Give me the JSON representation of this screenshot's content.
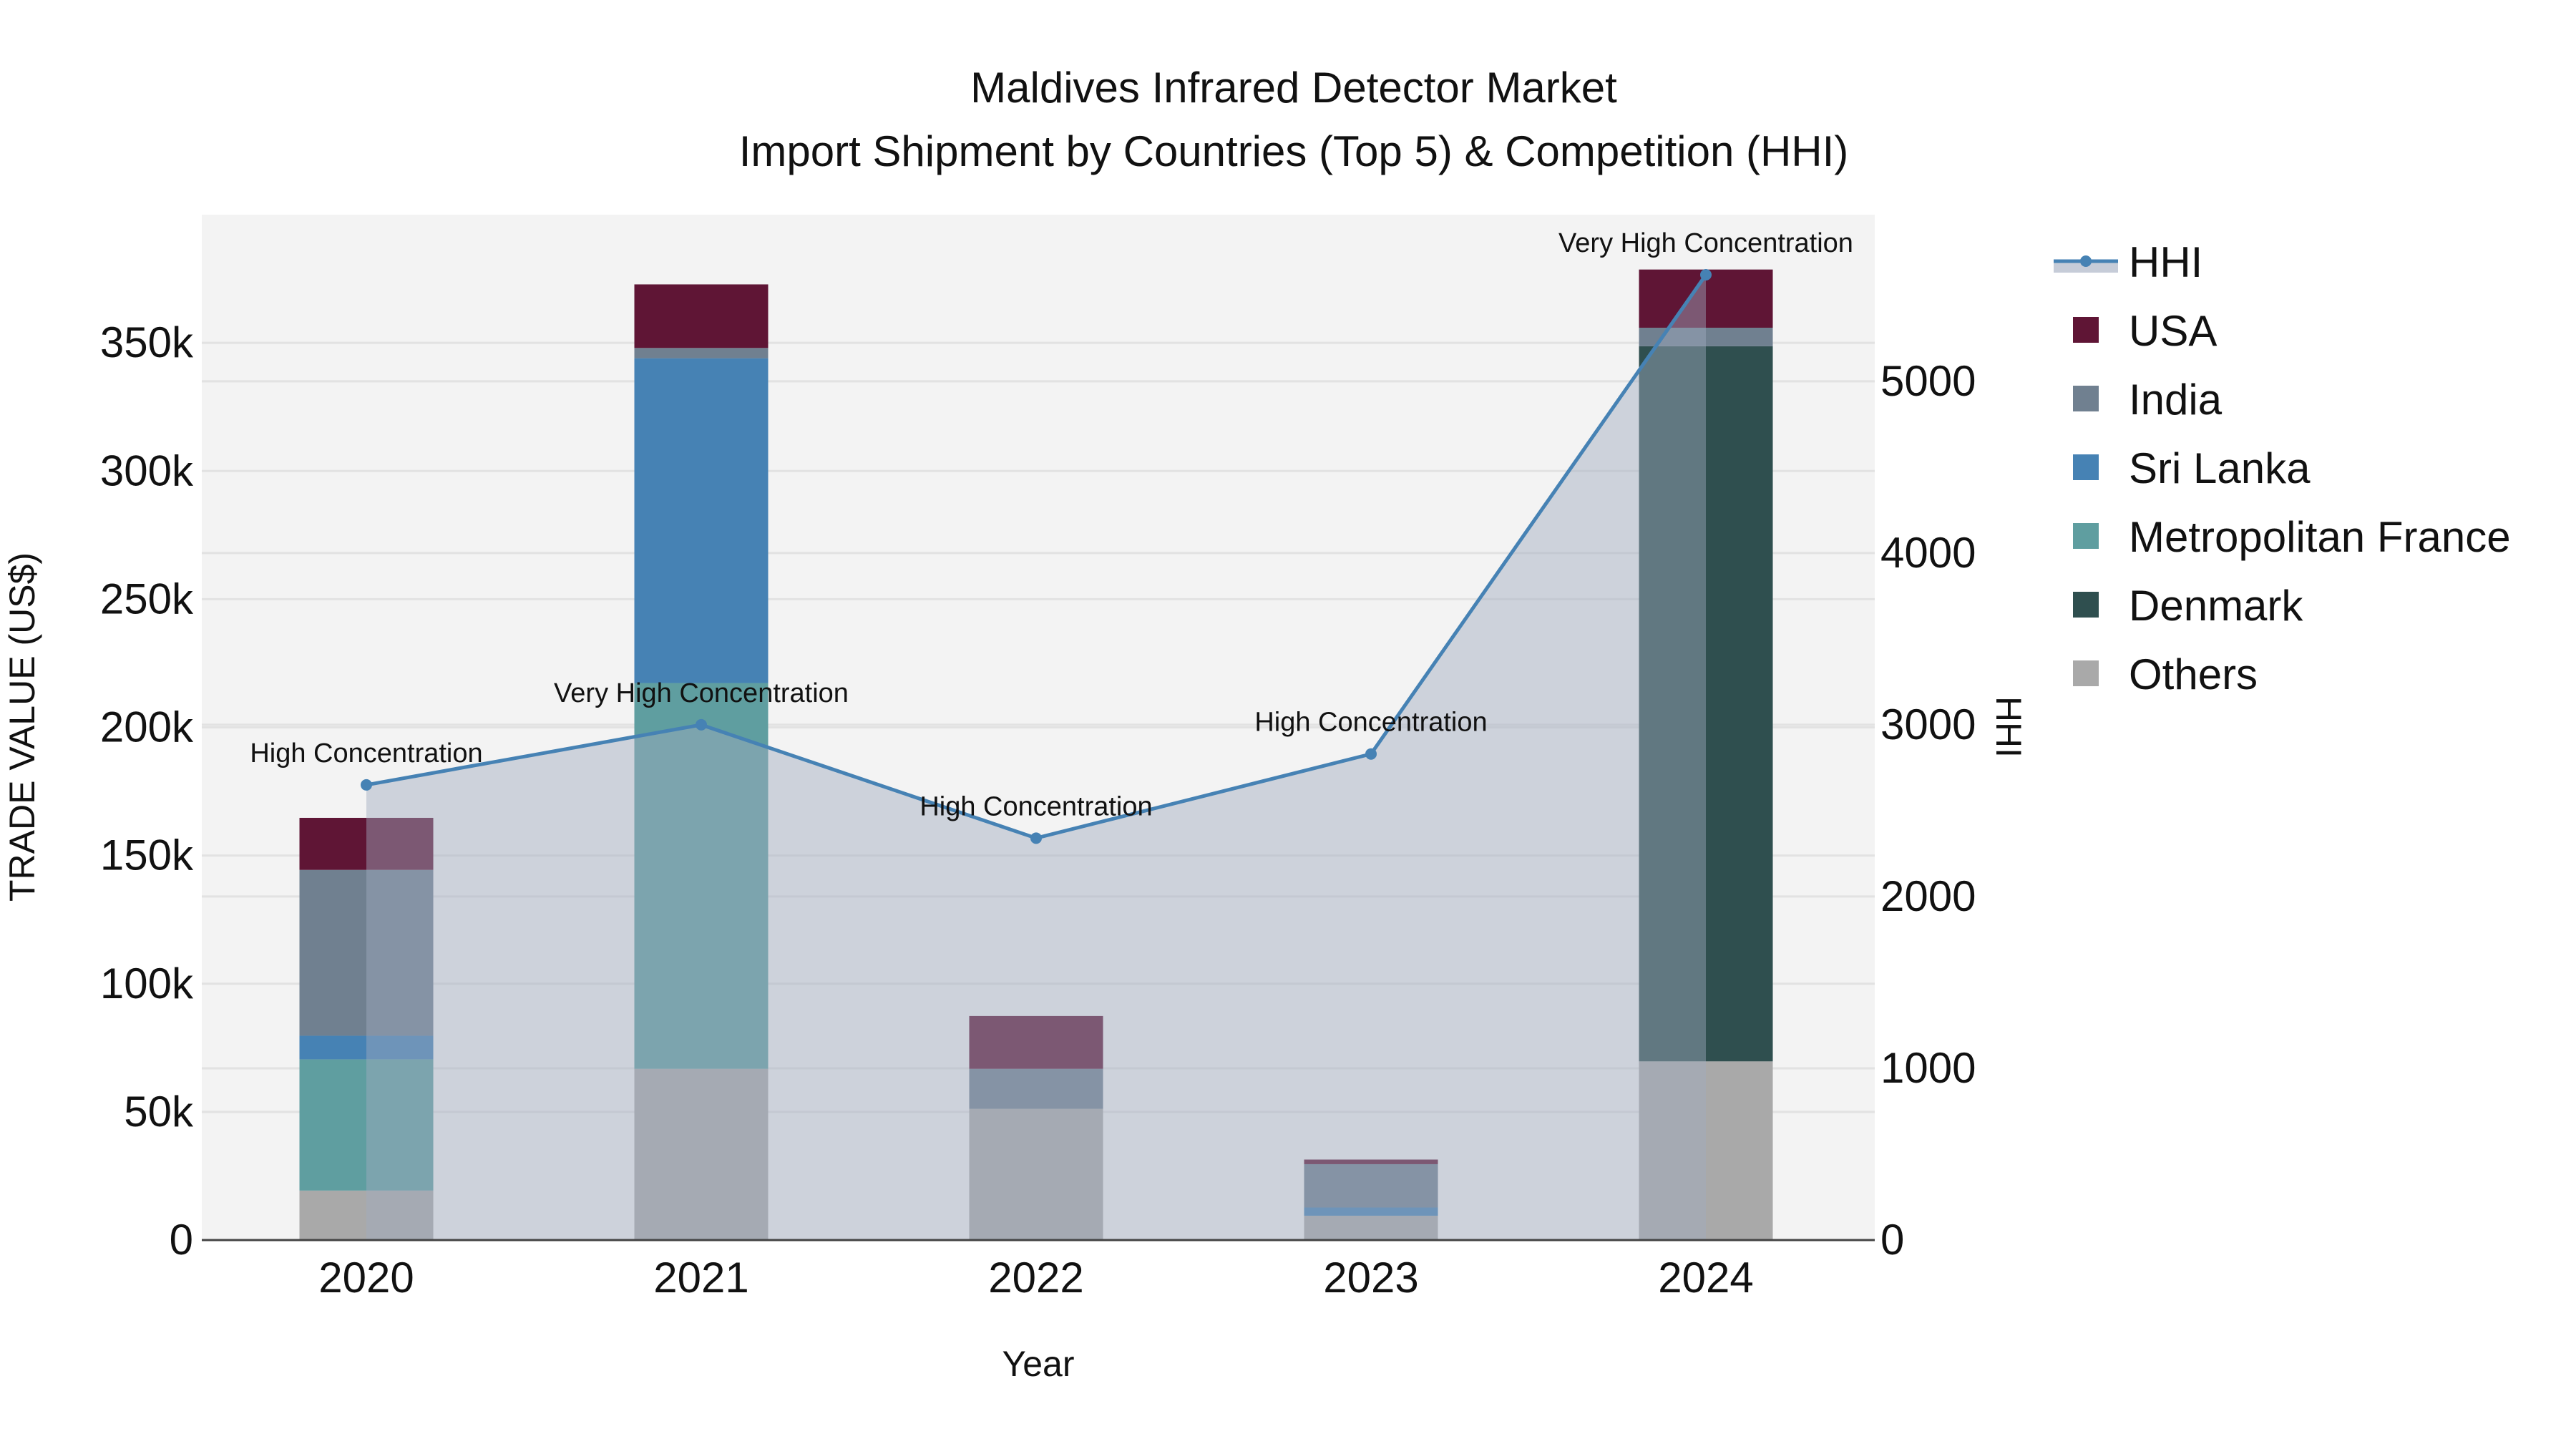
{
  "chart_data": {
    "type": "bar",
    "title": "Maldives Infrared Detector Market",
    "subtitle": "Import Shipment by Countries (Top 5) & Competition (HHI)",
    "xlabel": "Year",
    "ylabel": "TRADE VALUE (US$)",
    "y2label": "HHI",
    "categories": [
      "2020",
      "2021",
      "2022",
      "2023",
      "2024"
    ],
    "ylim": [
      0,
      400000
    ],
    "y2lim": [
      0,
      5970
    ],
    "yticks": [
      0,
      50000,
      100000,
      150000,
      200000,
      250000,
      300000,
      350000
    ],
    "ytick_labels": [
      "0",
      "50k",
      "100k",
      "150k",
      "200k",
      "250k",
      "300k",
      "350k"
    ],
    "y2ticks": [
      0,
      1000,
      2000,
      3000,
      4000,
      5000
    ],
    "y2tick_labels": [
      "0",
      "1000",
      "2000",
      "3000",
      "4000",
      "5000"
    ],
    "stacked": true,
    "series": [
      {
        "name": "Others",
        "color": "#a9a9a9",
        "values": [
          19300,
          66800,
          51200,
          9500,
          69700
        ]
      },
      {
        "name": "Denmark",
        "color": "#2f4f4f",
        "values": [
          0,
          0,
          0,
          0,
          279000
        ]
      },
      {
        "name": "Metropolitan France",
        "color": "#5f9ea0",
        "values": [
          51200,
          150500,
          0,
          0,
          0
        ]
      },
      {
        "name": "Sri Lanka",
        "color": "#4682b4",
        "values": [
          9200,
          126700,
          0,
          3200,
          0
        ]
      },
      {
        "name": "India",
        "color": "#708090",
        "values": [
          64700,
          4000,
          15600,
          16900,
          7200
        ]
      },
      {
        "name": "USA",
        "color": "#5f1535",
        "values": [
          20300,
          24800,
          20600,
          1800,
          22700
        ]
      }
    ],
    "line_series": {
      "name": "HHI",
      "axis": "right",
      "color": "#4682b4",
      "values": [
        2650,
        3000,
        2340,
        2830,
        5620
      ],
      "annotations": [
        "High Concentration",
        "Very High Concentration",
        "High Concentration",
        "High Concentration",
        "Very High Concentration"
      ]
    },
    "legend": {
      "placement": "right",
      "entries": [
        "HHI",
        "USA",
        "India",
        "Sri Lanka",
        "Metropolitan France",
        "Denmark",
        "Others"
      ]
    },
    "grid": true
  }
}
